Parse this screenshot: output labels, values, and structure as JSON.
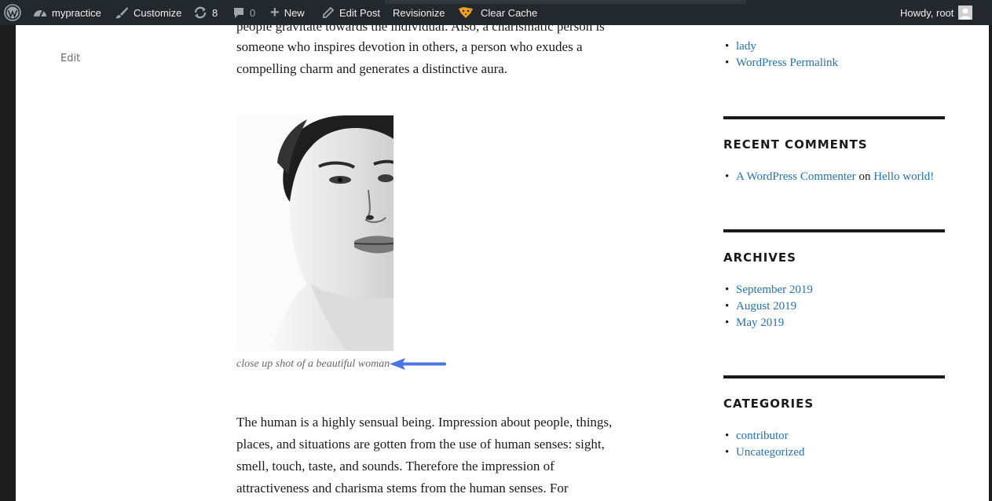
{
  "admin_bar": {
    "site_name": "mypractice",
    "customize_label": "Customize",
    "updates_count": "8",
    "comments_count": "0",
    "new_label": "New",
    "edit_post_label": "Edit Post",
    "revisionize_label": "Revisionize",
    "clear_cache_label": "Clear Cache",
    "howdy_label": "Howdy, root"
  },
  "post": {
    "edit_link": "Edit",
    "para1_cut_line": "people gravitate towards the individual. Also, a charismatic person is",
    "para1_lines": [
      "someone who inspires devotion in others, a person who exudes a",
      "compelling charm and generates a distinctive aura."
    ],
    "caption": "close up shot of a beautiful woman",
    "para2_lines": [
      "The human is a highly sensual being. Impression about people, things,",
      "places, and situations are gotten from the use of human senses: sight,",
      "smell, touch, taste, and sounds. Therefore the impression of",
      "attractiveness and charisma stems from the human senses. For"
    ]
  },
  "sidebar": {
    "recent_posts_tail": [
      "lady",
      "WordPress Permalink"
    ],
    "recent_comments": {
      "title": "RECENT COMMENTS",
      "author": "A WordPress Commenter",
      "on": "on",
      "post": "Hello world!"
    },
    "archives": {
      "title": "ARCHIVES",
      "items": [
        "September 2019",
        "August 2019",
        "May 2019"
      ]
    },
    "categories": {
      "title": "CATEGORIES",
      "items": [
        "contributor",
        "Uncategorized"
      ]
    }
  },
  "colors": {
    "admin_bar_bg": "#23282d",
    "link": "#2371b6",
    "arrow": "#4a74e0"
  }
}
